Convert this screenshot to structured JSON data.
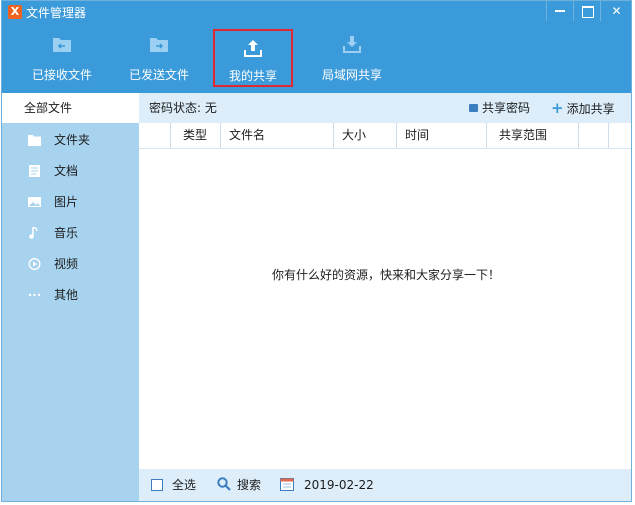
{
  "window": {
    "title": "文件管理器",
    "accent": "#3b9ad9",
    "logo_glyph": "X"
  },
  "toolbar": {
    "received": "已接收文件",
    "sent": "已发送文件",
    "my_share": "我的共享",
    "lan_share": "局域网共享"
  },
  "sidebar": {
    "header": "全部文件",
    "items": [
      {
        "label": "文件夹",
        "icon": "folder-icon"
      },
      {
        "label": "文档",
        "icon": "document-icon"
      },
      {
        "label": "图片",
        "icon": "image-icon"
      },
      {
        "label": "音乐",
        "icon": "music-icon"
      },
      {
        "label": "视频",
        "icon": "video-icon"
      },
      {
        "label": "其他",
        "icon": "more-icon"
      }
    ]
  },
  "main": {
    "password_status": "密码状态: 无",
    "share_password": "共享密码",
    "add_share": "添加共享",
    "columns": {
      "type": "类型",
      "name": "文件名",
      "size": "大小",
      "time": "时间",
      "scope": "共享范围"
    },
    "empty_message": "你有什么好的资源，快来和大家分享一下！"
  },
  "footer": {
    "select_all": "全选",
    "search": "搜索",
    "date": "2019-02-22"
  }
}
